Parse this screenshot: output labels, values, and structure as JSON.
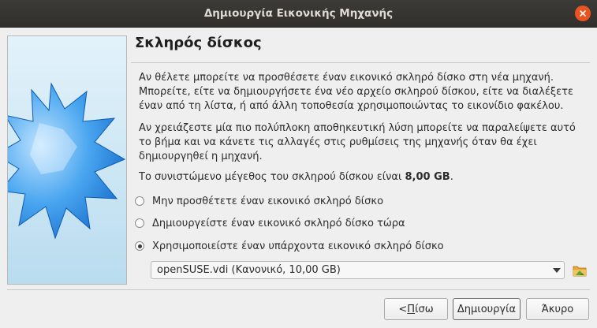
{
  "window": {
    "title": "Δημιουργία Εικονικής Μηχανής"
  },
  "page": {
    "heading": "Σκληρός δίσκος",
    "paragraph1": "Αν θέλετε μπορείτε να προσθέσετε έναν εικονικό σκληρό δίσκο στη νέα μηχανή. Μπορείτε, είτε να δημιουργήσετε ένα νέο αρχείο σκληρού δίσκου, είτε να διαλέξετε έναν από τη λίστα, ή από άλλη τοποθεσία χρησιμοποιώντας το εικονίδιο φακέλου.",
    "paragraph2": "Αν χρειάζεστε μία πιο πολύπλοκη αποθηκευτική λύση μπορείτε να παραλείψετε αυτό το βήμα και να κάνετε τις αλλαγές στις ρυθμίσεις της μηχανής όταν θα έχει δημιουργηθεί η μηχανή.",
    "recommended_prefix": "Το συνιστώμενο μέγεθος του σκληρού δίσκου είναι ",
    "recommended_size": "8,00 GB",
    "recommended_suffix": "."
  },
  "options": [
    {
      "label": "Μην προσθέτετε έναν εικονικό σκληρό δίσκο",
      "selected": false
    },
    {
      "label": "Δημιουργείστε έναν εικονικό σκληρό δίσκο τώρα",
      "selected": false
    },
    {
      "label": "Χρησιμοποιείστε έναν υπάρχοντα εικονικό σκληρό δίσκο",
      "selected": true
    }
  ],
  "disk_select": {
    "value": "openSUSE.vdi (Κανονικό, 10,00 GB)"
  },
  "buttons": {
    "back_mnemonic": "Π",
    "back_rest": "ίσω",
    "back_prefix": "< ",
    "create": "Δημιουργία",
    "cancel": "Άκυρο"
  },
  "colors": {
    "titlebar": "#3c3b37",
    "close": "#e95420",
    "background": "#efefef"
  },
  "icons": [
    "close-icon",
    "hard-disk-wizard-image",
    "dropdown-arrow-icon",
    "folder-icon"
  ]
}
